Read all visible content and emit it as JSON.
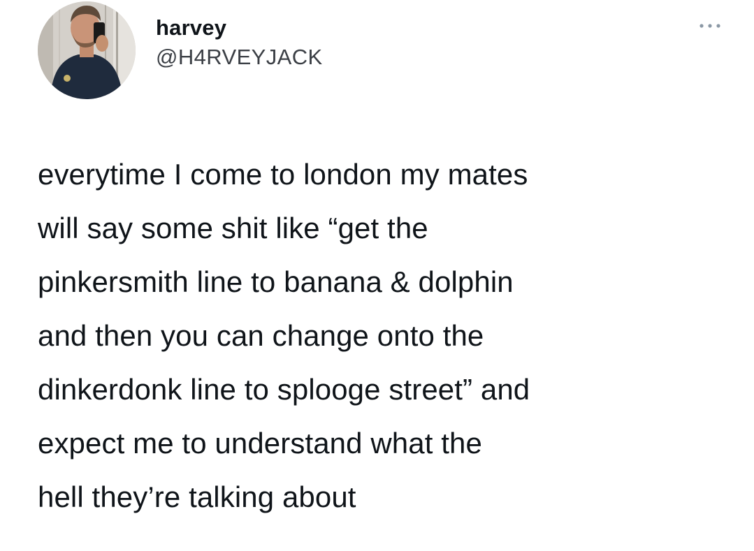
{
  "tweet": {
    "author": {
      "display_name": "harvey",
      "handle": "@H4RVEYJACK",
      "avatar_icon": "profile-photo"
    },
    "more_icon": "more-horizontal-icon",
    "text_lines": [
      "everytime I come to london my mates",
      "will say some shit like “get the",
      "pinkersmith line to banana & dolphin",
      "and then you can change onto the",
      "dinkerdonk line to splooge street” and",
      "expect me to understand what the",
      "hell they’re talking about"
    ]
  },
  "colors": {
    "text": "#0f1419",
    "handle": "#3b3f45",
    "background": "#ffffff",
    "more_icon": "#8b98a5"
  }
}
